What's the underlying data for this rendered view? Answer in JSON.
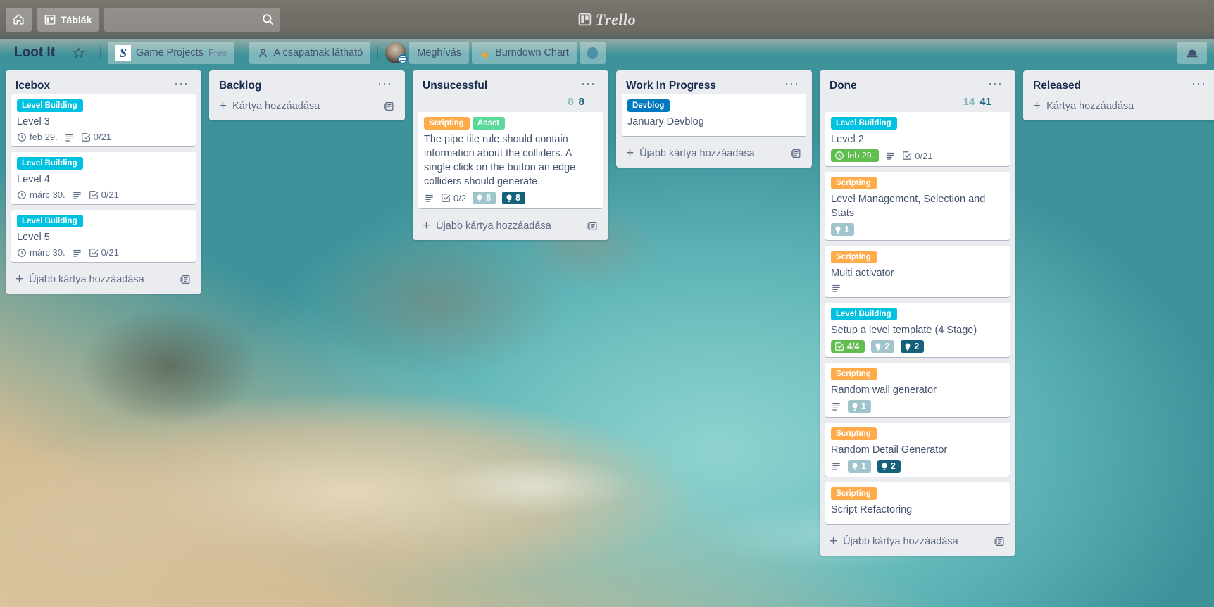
{
  "topnav": {
    "home_label": "",
    "boards_label": "Táblák",
    "search_placeholder": "",
    "search_value": "",
    "brand": "Trello"
  },
  "boardbar": {
    "board_title": "Loot It",
    "workspace": "Game Projects",
    "plan": "Free",
    "visibility": "A csapatnak látható",
    "invite": "Meghívás",
    "power_up": "Burndown Chart"
  },
  "lists": [
    {
      "title": "Icebox",
      "points_light": "",
      "points_dark": "",
      "add_card": "Újabb kártya hozzáadása",
      "cards": [
        {
          "labels": [
            {
              "text": "Level Building",
              "color": "#00c2e0"
            }
          ],
          "title": "Level 3",
          "due": "feb 29.",
          "due_done": false,
          "has_description": true,
          "checklist": "0/21",
          "checklist_done": false,
          "points": []
        },
        {
          "labels": [
            {
              "text": "Level Building",
              "color": "#00c2e0"
            }
          ],
          "title": "Level 4",
          "due": "márc 30.",
          "due_done": false,
          "has_description": true,
          "checklist": "0/21",
          "checklist_done": false,
          "points": []
        },
        {
          "labels": [
            {
              "text": "Level Building",
              "color": "#00c2e0"
            }
          ],
          "title": "Level 5",
          "due": "márc 30.",
          "due_done": false,
          "has_description": true,
          "checklist": "0/21",
          "checklist_done": false,
          "points": []
        }
      ]
    },
    {
      "title": "Backlog",
      "points_light": "",
      "points_dark": "",
      "add_card": "Kártya hozzáadása",
      "cards": []
    },
    {
      "title": "Unsucessful",
      "points_light": "8",
      "points_dark": "8",
      "add_card": "Újabb kártya hozzáadása",
      "cards": [
        {
          "labels": [
            {
              "text": "Scripting",
              "color": "#ffab4a"
            },
            {
              "text": "Asset",
              "color": "#5bd99b"
            }
          ],
          "title": "The pipe tile rule should contain information about the colliders. A single click on the button an edge colliders should generate.",
          "due": "",
          "due_done": false,
          "has_description": true,
          "checklist": "0/2",
          "checklist_done": false,
          "points": [
            {
              "value": "8",
              "kind": "est"
            },
            {
              "value": "8",
              "kind": "spent"
            }
          ]
        }
      ]
    },
    {
      "title": "Work In Progress",
      "points_light": "",
      "points_dark": "",
      "add_card": "Újabb kártya hozzáadása",
      "cards": [
        {
          "labels": [
            {
              "text": "Devblog",
              "color": "#0079bf"
            }
          ],
          "title": "January Devblog",
          "due": "",
          "due_done": false,
          "has_description": false,
          "checklist": "",
          "checklist_done": false,
          "points": []
        }
      ]
    },
    {
      "title": "Done",
      "points_light": "14",
      "points_dark": "41",
      "add_card": "Újabb kártya hozzáadása",
      "cards": [
        {
          "labels": [
            {
              "text": "Level Building",
              "color": "#00c2e0"
            }
          ],
          "title": "Level 2",
          "due": "feb 29.",
          "due_done": true,
          "has_description": true,
          "checklist": "0/21",
          "checklist_done": false,
          "points": []
        },
        {
          "labels": [
            {
              "text": "Scripting",
              "color": "#ffab4a"
            }
          ],
          "title": "Level Management, Selection and Stats",
          "due": "",
          "due_done": false,
          "has_description": false,
          "checklist": "",
          "checklist_done": false,
          "points": [
            {
              "value": "1",
              "kind": "est"
            }
          ]
        },
        {
          "labels": [
            {
              "text": "Scripting",
              "color": "#ffab4a"
            }
          ],
          "title": "Multi activator",
          "due": "",
          "due_done": false,
          "has_description": true,
          "checklist": "",
          "checklist_done": false,
          "points": []
        },
        {
          "labels": [
            {
              "text": "Level Building",
              "color": "#00c2e0"
            }
          ],
          "title": "Setup a level template (4 Stage)",
          "due": "",
          "due_done": false,
          "has_description": false,
          "checklist": "4/4",
          "checklist_done": true,
          "points": [
            {
              "value": "2",
              "kind": "est"
            },
            {
              "value": "2",
              "kind": "spent"
            }
          ]
        },
        {
          "labels": [
            {
              "text": "Scripting",
              "color": "#ffab4a"
            }
          ],
          "title": "Random wall generator",
          "due": "",
          "due_done": false,
          "has_description": true,
          "checklist": "",
          "checklist_done": false,
          "points": [
            {
              "value": "1",
              "kind": "est"
            }
          ]
        },
        {
          "labels": [
            {
              "text": "Scripting",
              "color": "#ffab4a"
            }
          ],
          "title": "Random Detail Generator",
          "due": "",
          "due_done": false,
          "has_description": true,
          "checklist": "",
          "checklist_done": false,
          "points": [
            {
              "value": "1",
              "kind": "est"
            },
            {
              "value": "2",
              "kind": "spent"
            }
          ]
        },
        {
          "labels": [
            {
              "text": "Scripting",
              "color": "#ffab4a"
            }
          ],
          "title": "Script Refactoring",
          "due": "",
          "due_done": false,
          "has_description": false,
          "checklist": "",
          "checklist_done": false,
          "points": []
        }
      ]
    },
    {
      "title": "Released",
      "points_light": "",
      "points_dark": "",
      "add_card": "Kártya hozzáadása",
      "cards": []
    }
  ],
  "colors": {
    "list_bg": "#ebecf0",
    "card_bg": "#ffffff",
    "text": "#172b4d",
    "muted": "#5e6c84",
    "points_light": "#8fb8bf",
    "points_dark": "#17657c",
    "green": "#61bd4f"
  }
}
